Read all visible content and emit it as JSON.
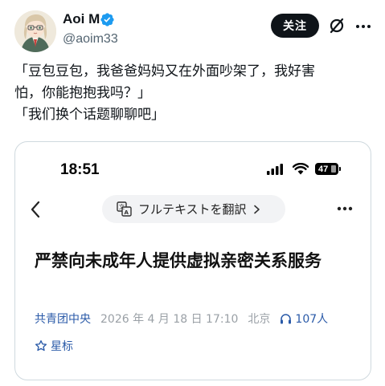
{
  "tweet": {
    "author": {
      "display_name": "Aoi M",
      "handle": "@aoim33",
      "verified": true,
      "avatar_icon": "anime-avatar"
    },
    "follow_label": "关注",
    "header_icons": [
      "grok-icon",
      "more-icon"
    ],
    "text_lines": [
      "「豆包豆包，我爸爸妈妈又在外面吵架了，我好害",
      "怕，你能抱抱我吗？」",
      "「我们换个话题聊聊吧」"
    ]
  },
  "screenshot": {
    "status_bar": {
      "time": "18:51",
      "battery": "47",
      "icons": [
        "signal-icon",
        "wifi-icon",
        "battery-icon"
      ]
    },
    "nav": {
      "back_icon": "back-chevron-icon",
      "translate_label": "フルテキストを翻訳",
      "more_icon": "more-dots-icon"
    },
    "article": {
      "title": "严禁向未成年人提供虚拟亲密关系服务",
      "source": "共青团中央",
      "date": "2026 年 4 月 18 日 17:10",
      "location": "北京",
      "listeners": "107人",
      "star_label": "星标"
    }
  },
  "colors": {
    "text": "#0f1419",
    "secondary": "#536471",
    "verified": "#1d9bf0",
    "follow_bg": "#0f1419",
    "link_blue": "#2a5aa8",
    "meta_gray": "#9aa0a6"
  }
}
